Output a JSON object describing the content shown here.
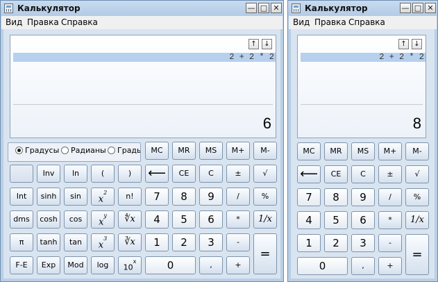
{
  "windows": [
    {
      "title": "Калькулятор",
      "menu": [
        "Вид",
        "Правка",
        "Справка"
      ],
      "history_up": "↑",
      "history_down": "↓",
      "expression": "2 + 2 * 2",
      "result": "6"
    },
    {
      "title": "Калькулятор",
      "menu": [
        "Вид",
        "Правка",
        "Справка"
      ],
      "history_up": "↑",
      "history_down": "↓",
      "expression": "2 + 2 * 2",
      "result": "8"
    }
  ],
  "window_buttons": {
    "minimize": "—",
    "maximize": "□",
    "close": "✕"
  },
  "angle_units": {
    "degrees": "Градусы",
    "radians": "Радианы",
    "grads": "Грады",
    "selected": "degrees"
  },
  "buttons": {
    "mc": "MC",
    "mr": "MR",
    "ms": "MS",
    "mplus": "M+",
    "mminus": "M-",
    "inv": "Inv",
    "ln": "ln",
    "lparen": "(",
    "rparen": ")",
    "backspace": "⟵",
    "ce": "CE",
    "c": "C",
    "plusminus": "±",
    "sqrt": "√",
    "int": "Int",
    "sinh": "sinh",
    "sin": "sin",
    "x2": "x",
    "x2_exp": "2",
    "fact": "n!",
    "d7": "7",
    "d8": "8",
    "d9": "9",
    "div": "/",
    "percent": "%",
    "dms": "dms",
    "cosh": "cosh",
    "cos": "cos",
    "xy": "x",
    "xy_exp": "y",
    "yroot": "∜x",
    "d4": "4",
    "d5": "5",
    "d6": "6",
    "mul": "*",
    "recip": "1/x",
    "pi": "π",
    "tanh": "tanh",
    "tan": "tan",
    "x3": "x",
    "x3_exp": "3",
    "cbrt": "∛x",
    "d1": "1",
    "d2": "2",
    "d3": "3",
    "sub": "-",
    "equals": "=",
    "fe": "F-E",
    "exp": "Exp",
    "mod": "Mod",
    "log": "log",
    "tenx": "10",
    "tenx_exp": "x",
    "d0": "0",
    "dot": ",",
    "add": "+"
  }
}
